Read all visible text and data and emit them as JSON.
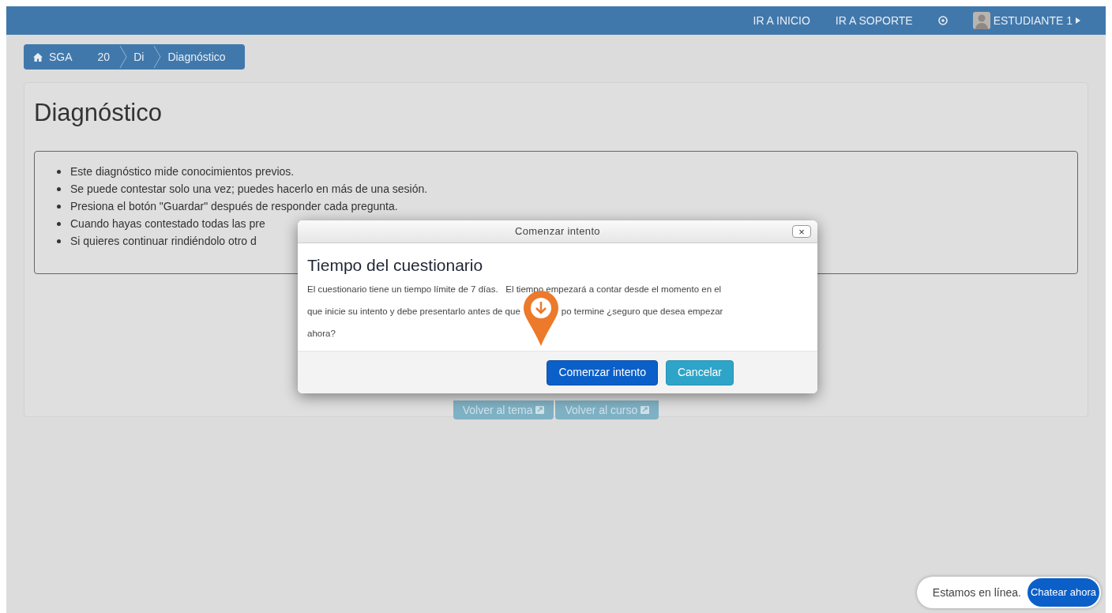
{
  "nav": {
    "links": [
      "IR A INICIO",
      "IR A SOPORTE"
    ],
    "user": "ESTUDIANTE 1"
  },
  "breadcrumb": [
    "SGA",
    "20",
    "Di",
    "Diagnóstico"
  ],
  "page": {
    "title": "Diagnóstico",
    "instructions": [
      "Este diagnóstico mide conocimientos previos.",
      "Se puede contestar solo una vez; puedes hacerlo en más de una sesión.",
      "Presiona el botón \"Guardar\" después de responder cada pregunta.",
      "Cuando hayas contestado todas las pre",
      "Si quieres continuar rindiéndolo otro d"
    ],
    "buttons": [
      "Volver al tema",
      "Volver al curso"
    ]
  },
  "dialog": {
    "title": "Comenzar intento",
    "close": "×",
    "heading": "Tiempo del cuestionario",
    "lines": [
      "El cuestionario tiene un tiempo límite de 7 días.   El tiempo empezará a contar desde el momento en el",
      "que inicie su intento y debe presentarlo antes de que",
      "po termine ¿seguro que desea empezar",
      "ahora?"
    ],
    "buttons": [
      {
        "label": "Comenzar intento",
        "kind": "primary"
      },
      {
        "label": "Cancelar",
        "kind": "secondary"
      }
    ]
  },
  "chat": {
    "status": "Estamos en línea.",
    "button": "Chatear ahora"
  }
}
